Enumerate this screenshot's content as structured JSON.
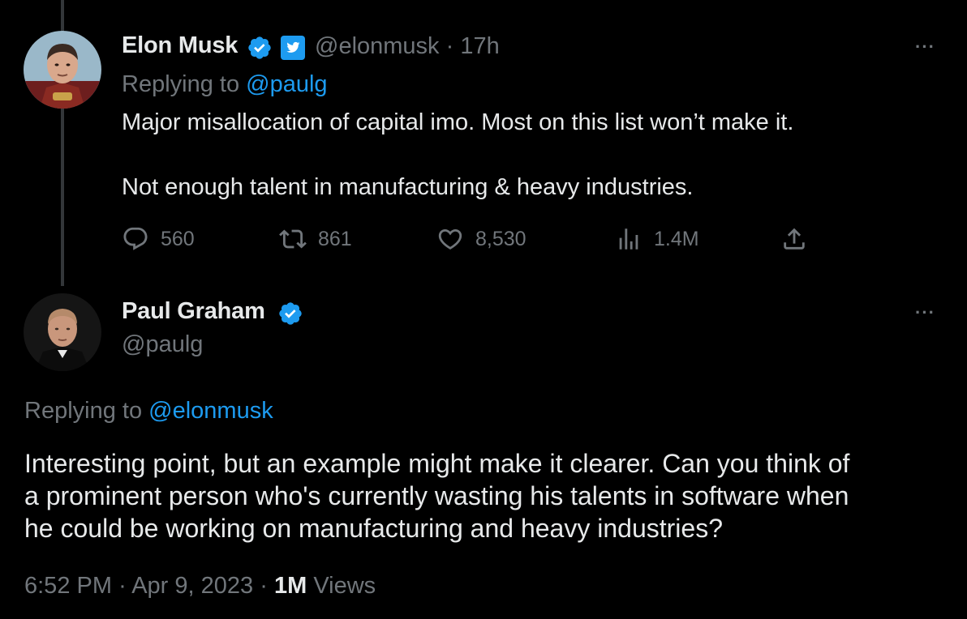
{
  "parent_tweet": {
    "author_name": "Elon Musk",
    "author_handle": "@elonmusk",
    "separator": "·",
    "time": "17h",
    "replying_prefix": "Replying to ",
    "replying_to": "@paulg",
    "text_line1": "Major misallocation of capital imo. Most on this list won’t make it.",
    "text_line2": "Not enough talent in manufacturing & heavy industries.",
    "more": "···",
    "actions": {
      "replies": "560",
      "retweets": "861",
      "likes": "8,530",
      "views": "1.4M"
    }
  },
  "main_tweet": {
    "author_name": "Paul Graham",
    "author_handle": "@paulg",
    "more": "···",
    "replying_prefix": "Replying to ",
    "replying_to": "@elonmusk",
    "text_line1": "Interesting point, but an example might make it clearer. Can you think of",
    "text_line2": "a prominent person who's currently wasting his talents in software when",
    "text_line3": "he could be working on manufacturing and heavy industries?",
    "time": "6:52 PM",
    "separator": "·",
    "date": "Apr 9, 2023",
    "separator2": "·",
    "views_count": "1M",
    "views_label": "Views"
  },
  "colors": {
    "background": "#000000",
    "text": "#e7e9ea",
    "muted": "#71767b",
    "link": "#1d9bf0",
    "verified": "#1d9bf0"
  },
  "icons": {
    "verified": "verified-badge-icon",
    "twitter_blue": "twitter-blue-icon",
    "reply": "reply-icon",
    "retweet": "retweet-icon",
    "like": "heart-icon",
    "views": "views-icon",
    "share": "share-icon",
    "more": "more-icon"
  }
}
